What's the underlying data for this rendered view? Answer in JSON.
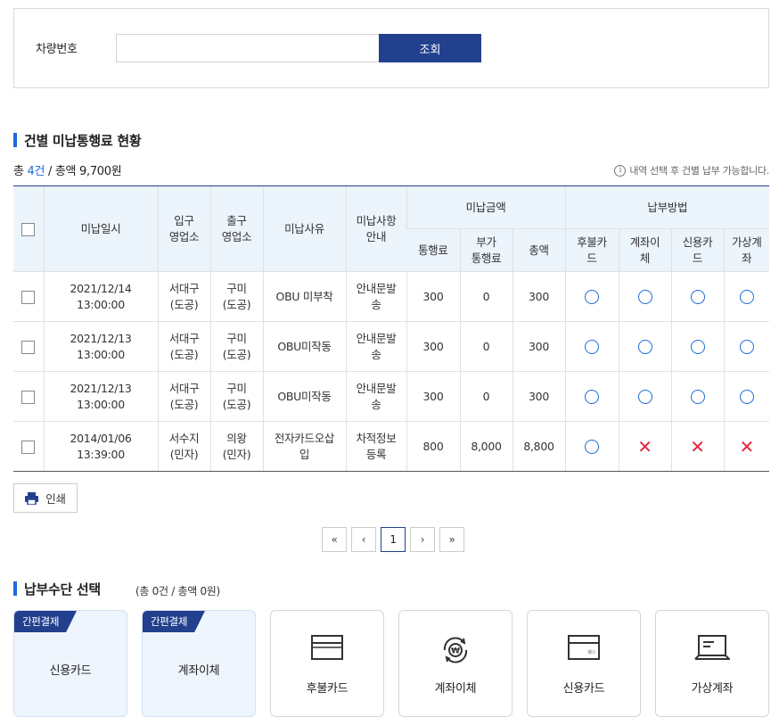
{
  "search": {
    "label": "차량번호",
    "value": "",
    "placeholder": "",
    "button_label": "조회"
  },
  "unpaid_section": {
    "title": "건별 미납통행료 현황",
    "summary_prefix": "총 ",
    "summary_count": "4건",
    "summary_suffix": " / 총액 9,700원",
    "notice": "내역 선택 후 건별 납부 가능합니다."
  },
  "table": {
    "headers": {
      "date": "미납일시",
      "entry": "입구\n영업소",
      "exit": "출구\n영업소",
      "reason": "미납사유",
      "guide": "미납사항\n안내",
      "amount_group": "미납금액",
      "toll": "통행료",
      "extra": "부가\n통행료",
      "total": "총액",
      "method_group": "납부방법",
      "postpaid": "후불카\n드",
      "transfer": "계좌이\n체",
      "credit": "신용카\n드",
      "virtual": "가상계\n좌"
    },
    "rows": [
      {
        "date": "2021/12/14 13:00:00",
        "entry": "서대구\n(도공)",
        "exit": "구미\n(도공)",
        "reason": "OBU 미부착",
        "guide": "안내문발\n송",
        "toll": "300",
        "extra": "0",
        "total": "300",
        "methods": [
          true,
          true,
          true,
          true
        ]
      },
      {
        "date": "2021/12/13 13:00:00",
        "entry": "서대구\n(도공)",
        "exit": "구미\n(도공)",
        "reason": "OBU미작동",
        "guide": "안내문발\n송",
        "toll": "300",
        "extra": "0",
        "total": "300",
        "methods": [
          true,
          true,
          true,
          true
        ]
      },
      {
        "date": "2021/12/13 13:00:00",
        "entry": "서대구\n(도공)",
        "exit": "구미\n(도공)",
        "reason": "OBU미작동",
        "guide": "안내문발\n송",
        "toll": "300",
        "extra": "0",
        "total": "300",
        "methods": [
          true,
          true,
          true,
          true
        ]
      },
      {
        "date": "2014/01/06 13:39:00",
        "entry": "서수지\n(민자)",
        "exit": "의왕\n(민자)",
        "reason": "전자카드오삽\n입",
        "guide": "차적정보\n등록",
        "toll": "800",
        "extra": "8,000",
        "total": "8,800",
        "methods": [
          true,
          false,
          false,
          false
        ]
      }
    ]
  },
  "print_label": "인쇄",
  "pagination": {
    "current": "1"
  },
  "payment_section": {
    "title": "납부수단 선택",
    "summary": "(총 0건 / 총액 0원)",
    "quick_tag": "간편결제",
    "quick_cards": [
      {
        "label": "신용카드"
      },
      {
        "label": "계좌이체"
      }
    ],
    "cards": [
      {
        "label": "후불카드",
        "icon": "postpaid-card-icon"
      },
      {
        "label": "계좌이체",
        "icon": "bank-transfer-icon"
      },
      {
        "label": "신용카드",
        "icon": "credit-card-icon"
      },
      {
        "label": "가상계좌",
        "icon": "virtual-account-icon"
      }
    ]
  },
  "colors": {
    "primary_navy": "#23408e",
    "accent_blue": "#1d6bd6",
    "header_bg": "#ecf4fc",
    "x_red": "#e0283e",
    "quick_card_bg": "#eef5fd"
  }
}
